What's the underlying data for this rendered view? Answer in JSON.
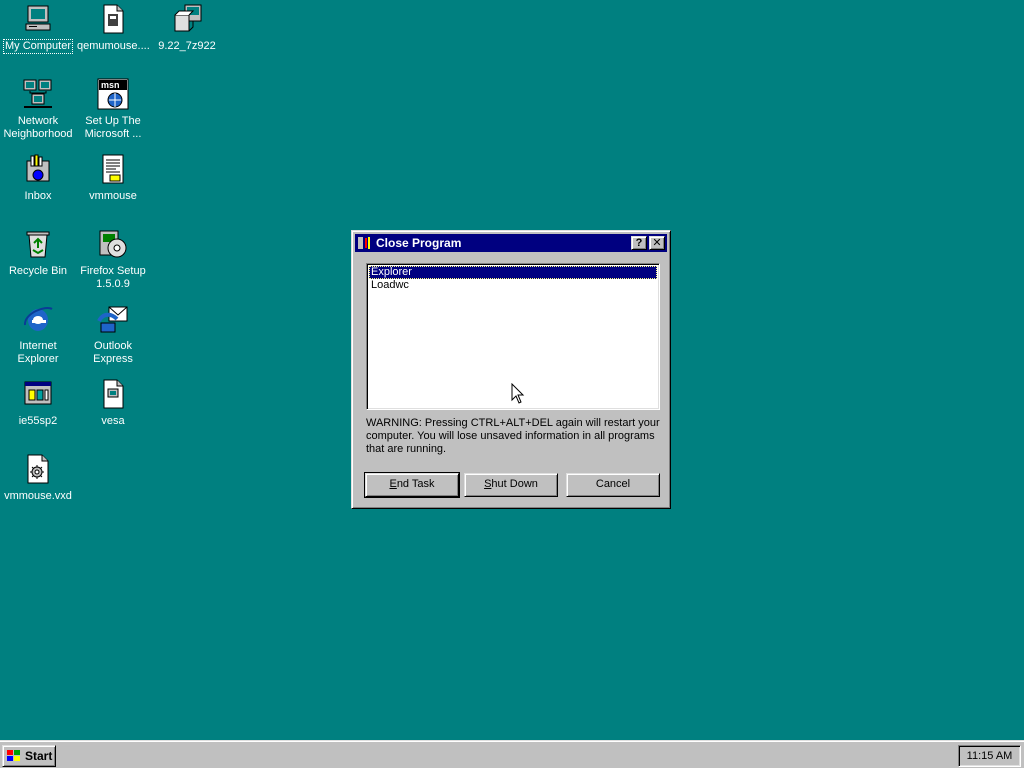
{
  "desktop": {
    "icons": [
      {
        "label": "My Computer"
      },
      {
        "label": "qemumouse...."
      },
      {
        "label": "9.22_7z922"
      },
      {
        "label": "Network Neighborhood"
      },
      {
        "label": "Set Up The Microsoft ..."
      },
      {
        "label": "Inbox"
      },
      {
        "label": "vmmouse"
      },
      {
        "label": "Recycle Bin"
      },
      {
        "label": "Firefox Setup 1.5.0.9"
      },
      {
        "label": "Internet Explorer"
      },
      {
        "label": "Outlook Express"
      },
      {
        "label": "ie55sp2"
      },
      {
        "label": "vesa"
      },
      {
        "label": "vmmouse.vxd"
      }
    ],
    "msn_logo_text": "msn"
  },
  "dialog": {
    "title": "Close Program",
    "help_button": "?",
    "close_button": "✕",
    "tasks": [
      "Explorer",
      "Loadwc"
    ],
    "selected_task": "Explorer",
    "warning": "WARNING: Pressing CTRL+ALT+DEL again will restart your computer. You will lose unsaved information in all programs that are running.",
    "buttons": {
      "end_task": {
        "mnemonic": "E",
        "rest": "nd Task"
      },
      "shut_down": {
        "mnemonic": "S",
        "rest": "hut Down"
      },
      "cancel": "Cancel"
    }
  },
  "taskbar": {
    "start_label": "Start",
    "clock": "11:15 AM"
  },
  "colors": {
    "desktop": "#008080",
    "titlebar": "#000080",
    "face": "#c0c0c0"
  }
}
